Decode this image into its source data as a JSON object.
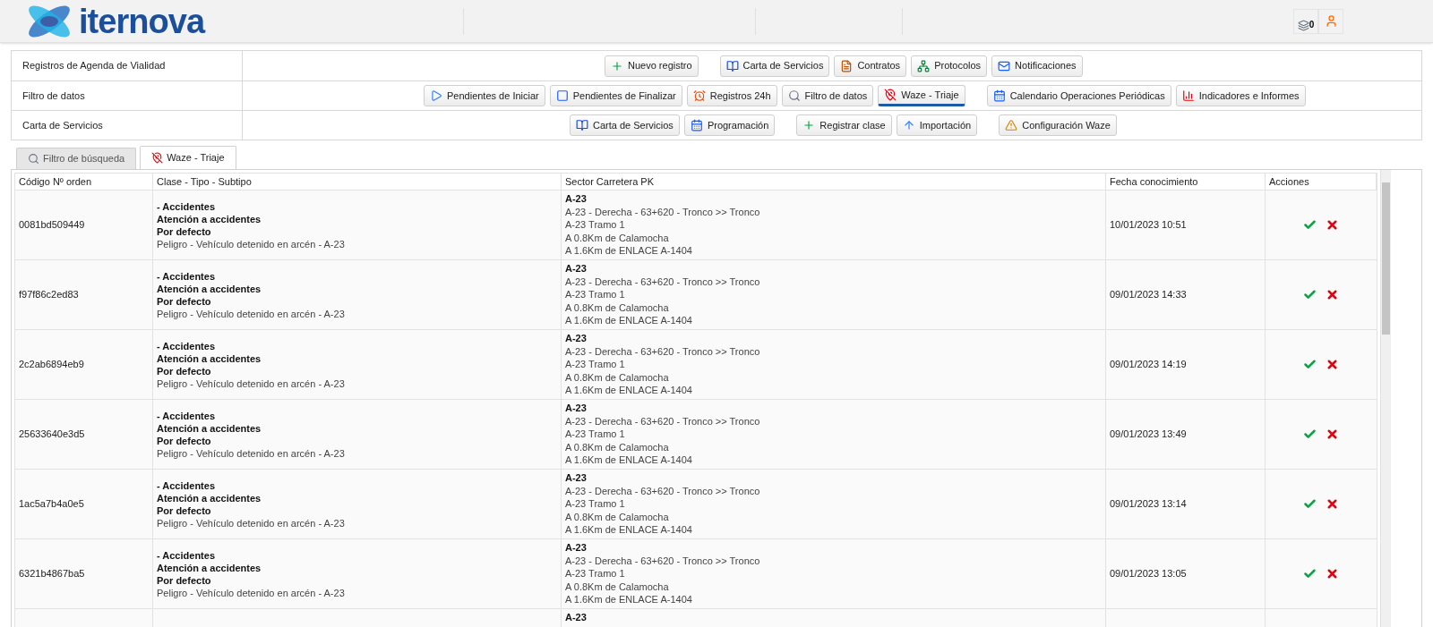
{
  "header": {
    "logo": "iternova",
    "notifications": {
      "count": "0"
    }
  },
  "nav": [
    {
      "label": "Registros de Agenda de Vialidad",
      "groups": [
        [
          {
            "label": "Nuevo registro",
            "selected": false
          }
        ],
        [
          {
            "label": "Carta de Servicios",
            "selected": false
          },
          {
            "label": "Contratos",
            "selected": false
          },
          {
            "label": "Protocolos",
            "selected": false
          },
          {
            "label": "Notificaciones",
            "selected": false
          }
        ]
      ]
    },
    {
      "label": "Filtro de datos",
      "groups": [
        [
          {
            "label": "Pendientes de Iniciar",
            "selected": false
          },
          {
            "label": "Pendientes de Finalizar",
            "selected": false
          },
          {
            "label": "Registros 24h",
            "selected": false
          },
          {
            "label": "Filtro de datos",
            "selected": false
          },
          {
            "label": "Waze - Triaje",
            "selected": true
          }
        ],
        [
          {
            "label": "Calendario Operaciones Periódicas",
            "selected": false
          },
          {
            "label": "Indicadores e Informes",
            "selected": false
          }
        ]
      ]
    },
    {
      "label": "Carta de Servicios",
      "groups": [
        [
          {
            "label": "Carta de Servicios",
            "selected": false
          },
          {
            "label": "Programación",
            "selected": false
          }
        ],
        [
          {
            "label": "Registrar clase",
            "selected": false
          },
          {
            "label": "Importación",
            "selected": false
          }
        ],
        [
          {
            "label": "Configuración Waze",
            "selected": false
          }
        ]
      ]
    }
  ],
  "tabs": [
    {
      "label": "Filtro de búsqueda",
      "selected": false
    },
    {
      "label": "Waze - Triaje",
      "selected": true
    }
  ],
  "table": {
    "columns": [
      "Código Nº orden",
      "Clase - Tipo - Subtipo",
      "Sector Carretera PK",
      "Fecha conocimiento",
      "Acciones"
    ],
    "rows": [
      {
        "code": "0081bd509449",
        "clase": [
          "- Accidentes",
          "Atención a accidentes",
          "Por defecto"
        ],
        "detalle": "Peligro - Vehículo detenido en arcén - A-23",
        "sector_title": "A-23",
        "sector_lines": [
          "A-23 - Derecha - 63+620 - Tronco >> Tronco",
          "A-23 Tramo 1",
          "A 0.8Km de Calamocha",
          "A 1.6Km de ENLACE A-1404"
        ],
        "fecha": "10/01/2023 10:51"
      },
      {
        "code": "f97f86c2ed83",
        "clase": [
          "- Accidentes",
          "Atención a accidentes",
          "Por defecto"
        ],
        "detalle": "Peligro - Vehículo detenido en arcén - A-23",
        "sector_title": "A-23",
        "sector_lines": [
          "A-23 - Derecha - 63+620 - Tronco >> Tronco",
          "A-23 Tramo 1",
          "A 0.8Km de Calamocha",
          "A 1.6Km de ENLACE A-1404"
        ],
        "fecha": "09/01/2023 14:33"
      },
      {
        "code": "2c2ab6894eb9",
        "clase": [
          "- Accidentes",
          "Atención a accidentes",
          "Por defecto"
        ],
        "detalle": "Peligro - Vehículo detenido en arcén - A-23",
        "sector_title": "A-23",
        "sector_lines": [
          "A-23 - Derecha - 63+620 - Tronco >> Tronco",
          "A-23 Tramo 1",
          "A 0.8Km de Calamocha",
          "A 1.6Km de ENLACE A-1404"
        ],
        "fecha": "09/01/2023 14:19"
      },
      {
        "code": "25633640e3d5",
        "clase": [
          "- Accidentes",
          "Atención a accidentes",
          "Por defecto"
        ],
        "detalle": "Peligro - Vehículo detenido en arcén - A-23",
        "sector_title": "A-23",
        "sector_lines": [
          "A-23 - Derecha - 63+620 - Tronco >> Tronco",
          "A-23 Tramo 1",
          "A 0.8Km de Calamocha",
          "A 1.6Km de ENLACE A-1404"
        ],
        "fecha": "09/01/2023 13:49"
      },
      {
        "code": "1ac5a7b4a0e5",
        "clase": [
          "- Accidentes",
          "Atención a accidentes",
          "Por defecto"
        ],
        "detalle": "Peligro - Vehículo detenido en arcén - A-23",
        "sector_title": "A-23",
        "sector_lines": [
          "A-23 - Derecha - 63+620 - Tronco >> Tronco",
          "A-23 Tramo 1",
          "A 0.8Km de Calamocha",
          "A 1.6Km de ENLACE A-1404"
        ],
        "fecha": "09/01/2023 13:14"
      },
      {
        "code": "6321b4867ba5",
        "clase": [
          "- Accidentes",
          "Atención a accidentes",
          "Por defecto"
        ],
        "detalle": "Peligro - Vehículo detenido en arcén - A-23",
        "sector_title": "A-23",
        "sector_lines": [
          "A-23 - Derecha - 63+620 - Tronco >> Tronco",
          "A-23 Tramo 1",
          "A 0.8Km de Calamocha",
          "A 1.6Km de ENLACE A-1404"
        ],
        "fecha": "09/01/2023 13:05"
      },
      {
        "sector_title": "A-23"
      }
    ]
  }
}
